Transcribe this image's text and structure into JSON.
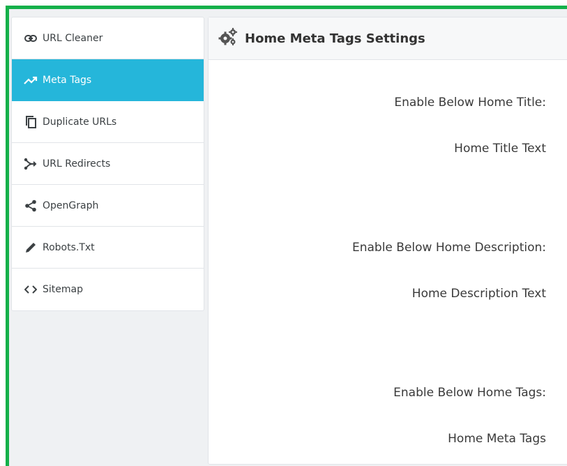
{
  "colors": {
    "accent": "#25b6da",
    "frame": "#14b04a",
    "background": "#eff1f3"
  },
  "sidebar": {
    "items": [
      {
        "label": "URL Cleaner",
        "icon": "link-icon",
        "active": false
      },
      {
        "label": "Meta Tags",
        "icon": "trending-up-icon",
        "active": true
      },
      {
        "label": "Duplicate URLs",
        "icon": "copy-icon",
        "active": false
      },
      {
        "label": "URL Redirects",
        "icon": "redirect-icon",
        "active": false
      },
      {
        "label": "OpenGraph",
        "icon": "share-icon",
        "active": false
      },
      {
        "label": "Robots.Txt",
        "icon": "pencil-icon",
        "active": false
      },
      {
        "label": "Sitemap",
        "icon": "code-icon",
        "active": false
      }
    ]
  },
  "panel": {
    "title": "Home Meta Tags Settings",
    "icon": "gears-icon",
    "fields": [
      {
        "label": "Enable Below Home Title:"
      },
      {
        "label": "Home Title Text"
      },
      {
        "label": "Enable Below Home Description:"
      },
      {
        "label": "Home Description Text"
      },
      {
        "label": "Enable Below Home Tags:"
      },
      {
        "label": "Home Meta Tags"
      }
    ]
  }
}
